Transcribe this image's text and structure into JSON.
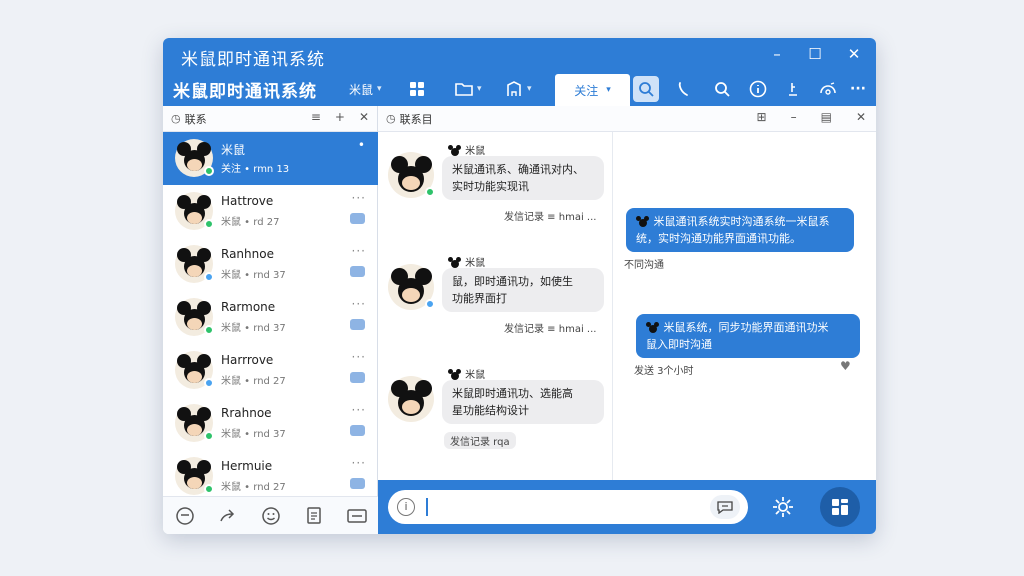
{
  "window": {
    "title": "米鼠即时通讯系统",
    "app_title": "米鼠即时通讯系统",
    "controls": {
      "minimize": "–",
      "maximize": "☐",
      "close": "✕"
    }
  },
  "toolbar": {
    "items": [
      {
        "label": "米鼠",
        "icon": "menu-icon"
      },
      {
        "label": "",
        "icon": "grid-icon"
      },
      {
        "label": "",
        "icon": "folder-icon"
      },
      {
        "label": "",
        "icon": "building-icon"
      }
    ],
    "active_tab": "关注",
    "icons": [
      "search-icon",
      "phone-icon",
      "magnifier-icon",
      "info-icon",
      "pin-icon",
      "settings-icon",
      "more-icon"
    ],
    "more_label": "···"
  },
  "contacts_panel": {
    "title": "联系",
    "contacts": [
      {
        "name": "米鼠",
        "sub": "关注 • rmn 13",
        "status": "online",
        "active": true
      },
      {
        "name": "Hattrove",
        "sub": "米鼠 • rd 27",
        "status": "online",
        "active": false
      },
      {
        "name": "Ranhnoe",
        "sub": "米鼠 • rnd 37",
        "status": "offline",
        "active": false
      },
      {
        "name": "Rarmone",
        "sub": "米鼠 • rnd 37",
        "status": "online",
        "active": false
      },
      {
        "name": "Harrrove",
        "sub": "米鼠 • rnd 27",
        "status": "offline",
        "active": false
      },
      {
        "name": "Rrahnoe",
        "sub": "米鼠 • rnd 37",
        "status": "online",
        "active": false
      },
      {
        "name": "Hermuie",
        "sub": "米鼠 • rnd 27",
        "status": "online",
        "active": false
      }
    ],
    "more_label": "···",
    "active_more_label": "•",
    "head_icons": {
      "sort": "≡",
      "add": "+",
      "close": "✕"
    }
  },
  "chat": {
    "title": "联系目",
    "head_icons": {
      "grid": "⊞",
      "minimize": "–",
      "window": "▤",
      "close": "✕"
    },
    "incoming": [
      {
        "sender": "米鼠",
        "text_line1": "米鼠通讯系、确通讯对内、",
        "text_line2": "实时功能实现讯",
        "meta": "发信记录 ≡ hmai ..."
      },
      {
        "sender": "米鼠",
        "text_line1": "鼠，即时通讯功，如使生",
        "text_line2": "功能界面打",
        "meta": "发信记录 ≡ hmai ..."
      },
      {
        "sender": "米鼠",
        "text_line1": "米鼠即时通讯功、选能高",
        "text_line2": "星功能结构设计",
        "meta": "发信记录 rqa"
      }
    ],
    "outgoing": [
      {
        "text_line1": "米鼠通讯系统实时沟通系统一米鼠系",
        "text_line2": "统，实时沟通功能界面通讯功能。",
        "meta": "不同沟通"
      },
      {
        "text_line1": "米鼠系统，同步功能界面通讯功米",
        "text_line2": "鼠入即时沟通",
        "meta": "发送 3个小时"
      }
    ]
  },
  "input": {
    "placeholder": "",
    "value": ""
  },
  "colors": {
    "primary": "#2e7dd6",
    "primary_dark": "#1e5ea8",
    "bubble_in": "#ededef",
    "online": "#2ec26a",
    "away": "#4aa3f0"
  }
}
